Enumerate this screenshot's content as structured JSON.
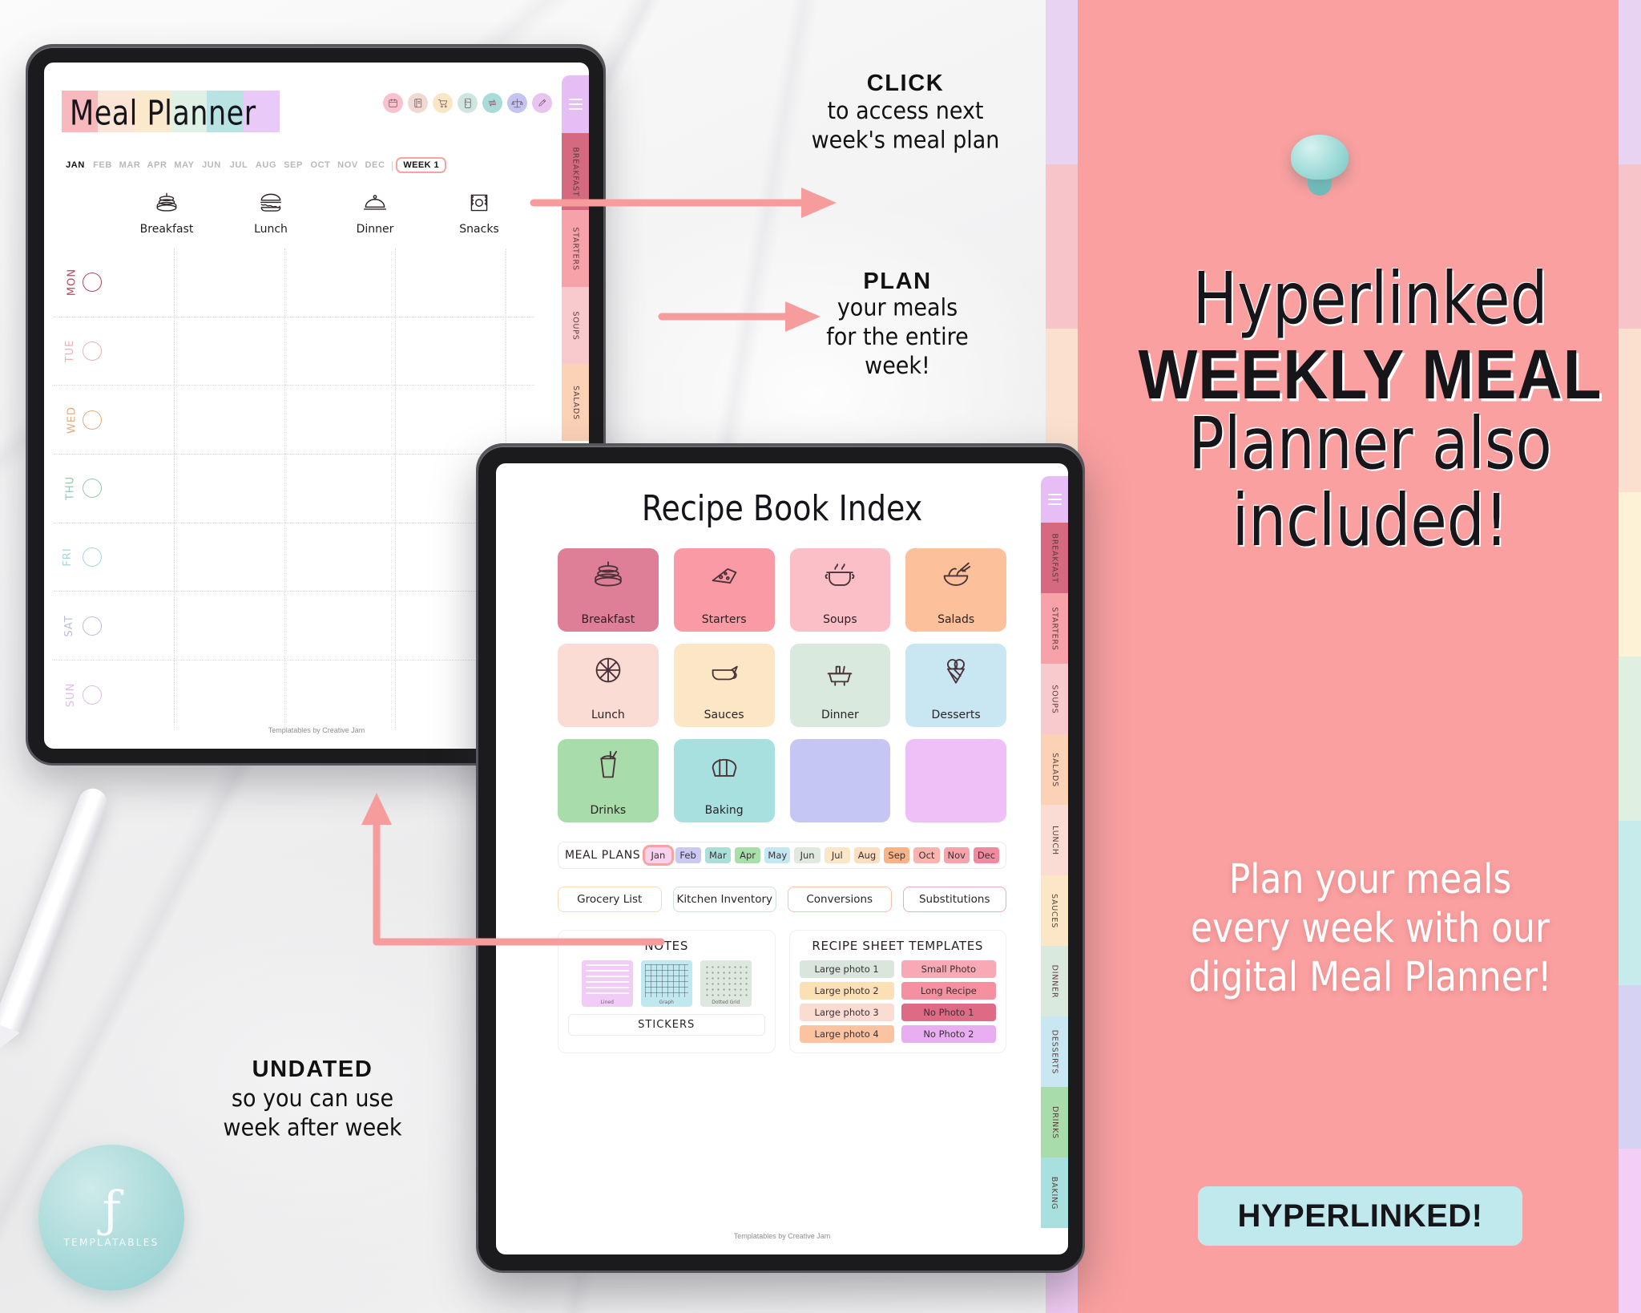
{
  "colors": {
    "pink_panel": "#faa0a0",
    "accent_arrow": "#f79c9c",
    "badge_bg": "#bfe9ec",
    "title_blocks": [
      "#f7b8be",
      "#fce5d6",
      "#fbe9cd",
      "#dff0e4",
      "#b9e3e3",
      "#e9c9f7"
    ],
    "edge_stripes": [
      "#e8d4f2",
      "#f7c4c9",
      "#fbe0cf",
      "#fdf2d5",
      "#dff0e0",
      "#c7eaea",
      "#d6d2f4",
      "#f3cef5"
    ]
  },
  "tablet1": {
    "title": "Meal Planner",
    "months": [
      "JAN",
      "FEB",
      "MAR",
      "APR",
      "MAY",
      "JUN",
      "JUL",
      "AUG",
      "SEP",
      "OCT",
      "NOV",
      "DEC"
    ],
    "active_month": "JAN",
    "separator": "|",
    "week_chip": "WEEK 1",
    "toolbar_icons": [
      {
        "name": "calendar-icon",
        "color": "#f8c3ce"
      },
      {
        "name": "notebook-icon",
        "color": "#efd9d2"
      },
      {
        "name": "shopping-cart-icon",
        "color": "#fbe6c3"
      },
      {
        "name": "fridge-inventory-icon",
        "color": "#cfe6e0"
      },
      {
        "name": "substitutions-icon",
        "color": "#a9dcd8"
      },
      {
        "name": "conversions-scale-icon",
        "color": "#c3c4ef"
      },
      {
        "name": "pencil-icon",
        "color": "#e9c4f0"
      }
    ],
    "meal_columns": [
      {
        "label": "Breakfast",
        "icon": "pancakes-icon"
      },
      {
        "label": "Lunch",
        "icon": "burger-icon"
      },
      {
        "label": "Dinner",
        "icon": "cloche-icon"
      },
      {
        "label": "Snacks",
        "icon": "snack-bag-icon"
      }
    ],
    "days": [
      {
        "label": "MON",
        "color": "#b0485f"
      },
      {
        "label": "TUE",
        "color": "#f0aeb6"
      },
      {
        "label": "WED",
        "color": "#e8ab7c"
      },
      {
        "label": "THU",
        "color": "#94c9ab"
      },
      {
        "label": "FRI",
        "color": "#a4d7dc"
      },
      {
        "label": "SAT",
        "color": "#bdbce0"
      },
      {
        "label": "SUN",
        "color": "#dfbce6"
      }
    ],
    "side_tabs": [
      {
        "label": "BREAKFAST",
        "color": "#d4697f"
      },
      {
        "label": "STARTERS",
        "color": "#f6a2a8"
      },
      {
        "label": "SOUPS",
        "color": "#f8c9cd"
      },
      {
        "label": "SALADS",
        "color": "#fbd2b6"
      }
    ],
    "menu_tab_color": "#e6bdf4",
    "credit": "Templatables by Creative Jam"
  },
  "tablet2": {
    "title": "Recipe Book Index",
    "categories": [
      {
        "label": "Breakfast",
        "color": "#df7e97",
        "icon": "pancakes-icon"
      },
      {
        "label": "Starters",
        "color": "#f99aa5",
        "icon": "cheese-wedge-icon"
      },
      {
        "label": "Soups",
        "color": "#fbbfc7",
        "icon": "soup-pot-icon"
      },
      {
        "label": "Salads",
        "color": "#fcc19a",
        "icon": "salad-bowl-icon"
      },
      {
        "label": "Lunch",
        "color": "#fbdcd5",
        "icon": "pizza-icon"
      },
      {
        "label": "Sauces",
        "color": "#fbe6c6",
        "icon": "gravy-boat-icon"
      },
      {
        "label": "Dinner",
        "color": "#d9e9dd",
        "icon": "dinner-table-icon"
      },
      {
        "label": "Desserts",
        "color": "#c9e7f2",
        "icon": "ice-cream-cone-icon"
      },
      {
        "label": "Drinks",
        "color": "#a8dcab",
        "icon": "smoothie-glass-icon"
      },
      {
        "label": "Baking",
        "color": "#a8e0df",
        "icon": "bread-loaf-icon"
      },
      {
        "label": "",
        "color": "#c6c6f5",
        "icon": ""
      },
      {
        "label": "",
        "color": "#eec0f7",
        "icon": ""
      }
    ],
    "meal_plans_label": "MEAL PLANS",
    "meal_plan_months": [
      {
        "label": "Jan",
        "color": "#f8d2ec",
        "selected": true
      },
      {
        "label": "Feb",
        "color": "#c9c9f2",
        "selected": false
      },
      {
        "label": "Mar",
        "color": "#aadfd9",
        "selected": false
      },
      {
        "label": "Apr",
        "color": "#a9dfa8",
        "selected": false
      },
      {
        "label": "May",
        "color": "#c3e7f3",
        "selected": false
      },
      {
        "label": "Jun",
        "color": "#dfe9de",
        "selected": false
      },
      {
        "label": "Jul",
        "color": "#fbe7c8",
        "selected": false
      },
      {
        "label": "Aug",
        "color": "#fbddc0",
        "selected": false
      },
      {
        "label": "Sep",
        "color": "#f8b487",
        "selected": false
      },
      {
        "label": "Oct",
        "color": "#f8b4ad",
        "selected": false
      },
      {
        "label": "Nov",
        "color": "#f6a4ab",
        "selected": false
      },
      {
        "label": "Dec",
        "color": "#ef8a9f",
        "selected": false
      }
    ],
    "link_buttons": [
      {
        "label": "Grocery List",
        "border": "#fbd9b5"
      },
      {
        "label": "Kitchen Inventory",
        "border": "#cfe0d6"
      },
      {
        "label": "Conversions",
        "border": "#f6c0ae"
      },
      {
        "label": "Substitutions",
        "border": "#e8aeb4"
      }
    ],
    "notes": {
      "title": "NOTES",
      "thumbs": [
        {
          "label": "Lined",
          "color": "#f0ccf7"
        },
        {
          "label": "Graph",
          "color": "#bfe9ef"
        },
        {
          "label": "Dotted Grid",
          "color": "#dde9df"
        }
      ],
      "stickers_label": "STICKERS"
    },
    "templates": {
      "title": "RECIPE SHEET TEMPLATES",
      "items": [
        {
          "label": "Large photo 1",
          "color": "#d9e5dd"
        },
        {
          "label": "Small Photo",
          "color": "#f8a9b5"
        },
        {
          "label": "Large photo 2",
          "color": "#fbdfb5"
        },
        {
          "label": "Long Recipe",
          "color": "#f4909f"
        },
        {
          "label": "Large photo 3",
          "color": "#fbdcd3"
        },
        {
          "label": "No Photo 1",
          "color": "#de6a86"
        },
        {
          "label": "Large photo 4",
          "color": "#fbc3a0"
        },
        {
          "label": "No Photo 2",
          "color": "#e9aef2"
        }
      ]
    },
    "side_tabs": [
      {
        "label": "BREAKFAST",
        "color": "#d4697f"
      },
      {
        "label": "STARTERS",
        "color": "#f6a2a8"
      },
      {
        "label": "SOUPS",
        "color": "#f8c9cd"
      },
      {
        "label": "SALADS",
        "color": "#fbd2b6"
      },
      {
        "label": "LUNCH",
        "color": "#fbdcd5"
      },
      {
        "label": "SAUCES",
        "color": "#fbe6c6"
      },
      {
        "label": "DINNER",
        "color": "#d9e9dd"
      },
      {
        "label": "DESSERTS",
        "color": "#c9e7f2"
      },
      {
        "label": "DRINKS",
        "color": "#a8dcab"
      },
      {
        "label": "BAKING",
        "color": "#a8e0df"
      }
    ],
    "menu_tab_color": "#e6bdf4",
    "credit": "Templatables by Creative Jam"
  },
  "annotations": {
    "click": {
      "heading": "CLICK",
      "body": "to access next\nweek's meal plan"
    },
    "plan": {
      "heading": "PLAN",
      "body": "your meals\nfor the entire\nweek!"
    },
    "undated": {
      "heading": "UNDATED",
      "body": "so you can use\nweek after week"
    }
  },
  "right_panel": {
    "line1": "Hyperlinked",
    "line2": "WEEKLY MEAL",
    "line3": "Planner also\nincluded!",
    "subtext": "Plan your meals\nevery week with our\ndigital Meal Planner!",
    "badge": "HYPERLINKED!"
  },
  "logo": {
    "mark": "ƒ",
    "name": "TEMPLATABLES"
  }
}
